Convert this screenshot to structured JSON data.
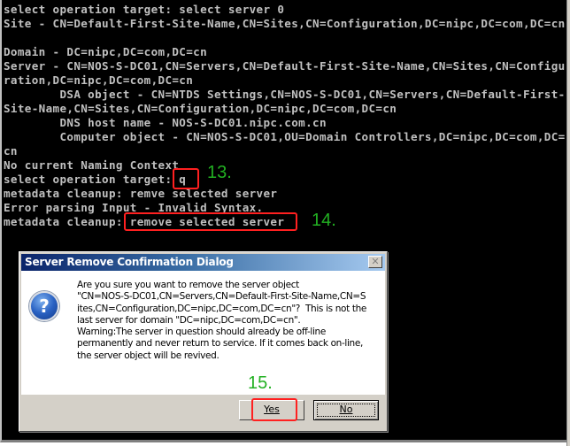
{
  "console": {
    "lines": [
      "select operation target: select server 0",
      "Site - CN=Default-First-Site-Name,CN=Sites,CN=Configuration,DC=nipc,DC=com,DC=cn",
      "",
      "Domain - DC=nipc,DC=com,DC=cn",
      "Server - CN=NOS-S-DC01,CN=Servers,CN=Default-First-Site-Name,CN=Sites,CN=Configu",
      "ration,DC=nipc,DC=com,DC=cn",
      "        DSA object - CN=NTDS Settings,CN=NOS-S-DC01,CN=Servers,CN=Default-First-",
      "Site-Name,CN=Sites,CN=Configuration,DC=nipc,DC=com,DC=cn",
      "        DNS host name - NOS-S-DC01.nipc.com.cn",
      "        Computer object - CN=NOS-S-DC01,OU=Domain Controllers,DC=nipc,DC=com,DC=",
      "cn",
      "No current Naming Context",
      "select operation target: q",
      "metadata cleanup: remve selected server",
      "Error parsing Input - Invalid Syntax.",
      "metadata cleanup: remove selected server"
    ]
  },
  "annotations": {
    "step13": "13.",
    "step14": "14.",
    "step15": "15.",
    "highlight_color": "#ff2020",
    "step_color": "#22b022"
  },
  "dialog": {
    "title": "Server Remove Confirmation Dialog",
    "close_glyph": "✕",
    "icon": "question-icon",
    "icon_glyph": "?",
    "message_lines": [
      "Are you sure you want to remove the server object",
      "\"CN=NOS-S-DC01,CN=Servers,CN=Default-First-Site-Name,CN=S",
      "ites,CN=Configuration,DC=nipc,DC=com,DC=cn\"?  This is not the",
      "last server for domain \"DC=nipc,DC=com,DC=cn\".",
      "Warning:The server in question should already be off-line",
      "permanently and never return to service. If it comes back on-line,",
      "the server object will be revived."
    ],
    "buttons": {
      "yes": "Yes",
      "no": "No"
    }
  }
}
